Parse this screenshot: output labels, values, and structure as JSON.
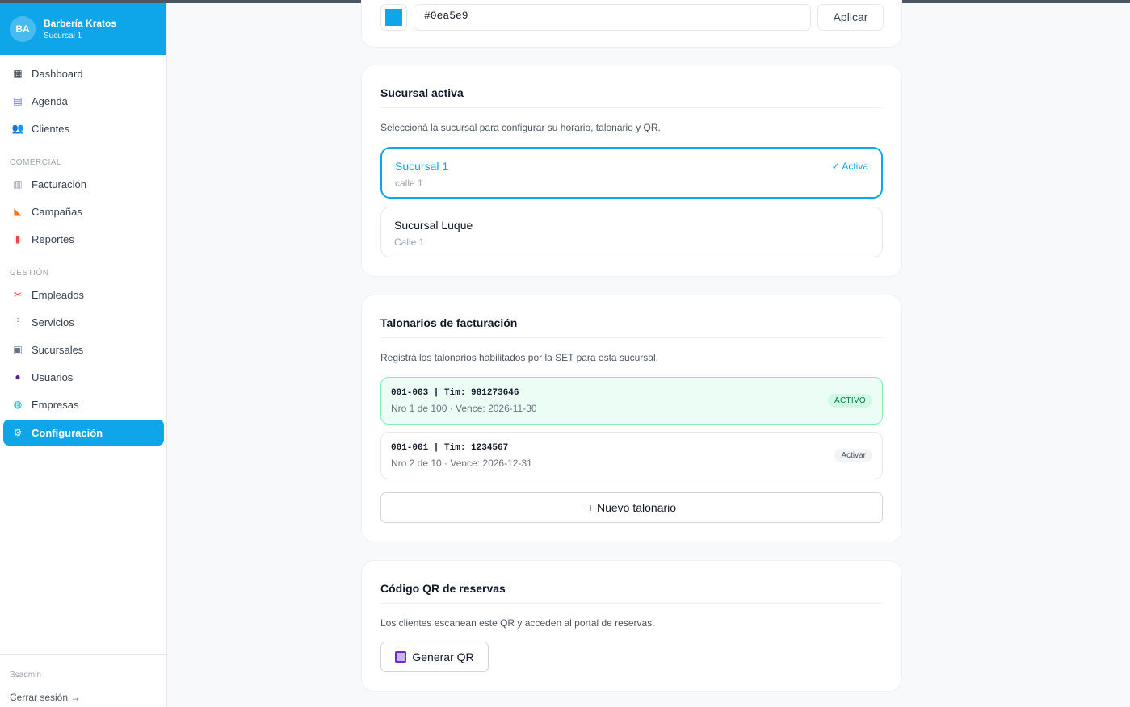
{
  "sidebar": {
    "avatar": "BA",
    "business_name": "Barbería Kratos",
    "branch": "Sucursal 1",
    "items": [
      {
        "label": "Dashboard",
        "icon": "grid-icon"
      },
      {
        "label": "Agenda",
        "icon": "calendar-icon"
      },
      {
        "label": "Clientes",
        "icon": "people-icon"
      }
    ],
    "section_comercial": "COMERCIAL",
    "comercial_items": [
      {
        "label": "Facturación",
        "icon": "receipt-icon"
      },
      {
        "label": "Campañas",
        "icon": "megaphone-icon"
      },
      {
        "label": "Reportes",
        "icon": "chart-icon"
      }
    ],
    "section_gestion": "GESTIÓN",
    "gestion_items": [
      {
        "label": "Empleados",
        "icon": "scissors-icon"
      },
      {
        "label": "Servicios",
        "icon": "barber-pole-icon"
      },
      {
        "label": "Sucursales",
        "icon": "building-icon"
      },
      {
        "label": "Usuarios",
        "icon": "user-icon"
      },
      {
        "label": "Empresas",
        "icon": "globe-icon"
      },
      {
        "label": "Configuración",
        "icon": "gear-icon",
        "active": true
      }
    ],
    "user": "Bsadmin",
    "logout": "Cerrar sesión →"
  },
  "color_settings": {
    "value": "#0ea5e9",
    "apply_label": "Aplicar"
  },
  "active_branch": {
    "title": "Sucursal activa",
    "description": "Seleccioná la sucursal para configurar su horario, talonario y QR.",
    "branches": [
      {
        "name": "Sucursal 1",
        "address": "calle 1",
        "flag": "✓ Activa"
      },
      {
        "name": "Sucursal Luque",
        "address": "Calle 1"
      }
    ]
  },
  "talonarios": {
    "title": "Talonarios de facturación",
    "description": "Registrá los talonarios habilitados por la SET para esta sucursal.",
    "items": [
      {
        "code": "001-003 | Tim: 981273646",
        "meta": "Nro 1 de 100 · Vence: 2026-11-30",
        "badge": "ACTIVO"
      },
      {
        "code": "001-001 | Tim: 1234567",
        "meta": "Nro 2 de 10 · Vence: 2026-12-31",
        "badge": "Activar"
      }
    ],
    "new_label": "+ Nuevo talonario"
  },
  "qr": {
    "title": "Código QR de reservas",
    "description": "Los clientes escanean este QR y acceden al portal de reservas.",
    "button_label": "Generar QR"
  },
  "colors": {
    "accent": "#0ea5e9",
    "active_row_bg": "#ecfdf5",
    "active_badge_text": "#047857"
  }
}
